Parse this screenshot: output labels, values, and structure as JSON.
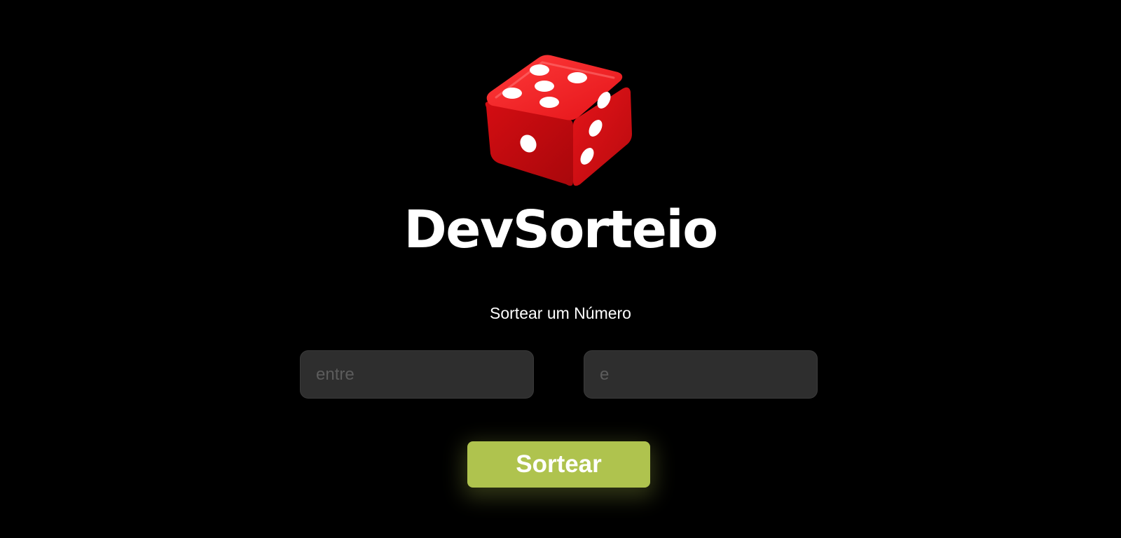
{
  "app": {
    "title": "DevSorteio",
    "logo_icon": "dice-icon"
  },
  "colors": {
    "background": "#000000",
    "accent": "#afc34e",
    "input_background": "#2e2e2e",
    "dice_red": "#e4161b"
  },
  "form": {
    "heading": "Sortear um Número",
    "min_input": {
      "placeholder": "entre",
      "value": ""
    },
    "max_input": {
      "placeholder": "e",
      "value": ""
    },
    "submit_label": "Sortear"
  }
}
